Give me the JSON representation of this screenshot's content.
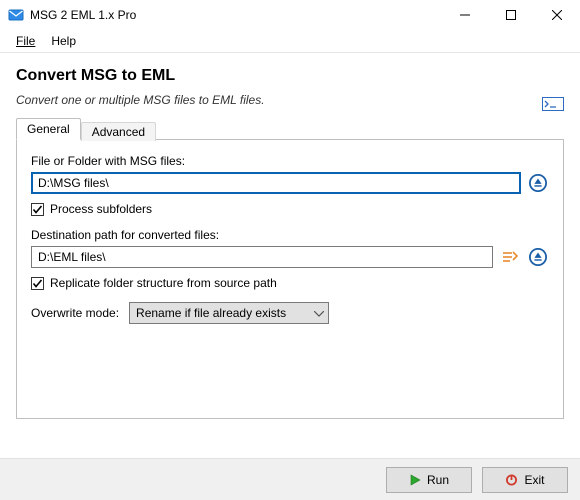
{
  "window": {
    "title": "MSG 2 EML 1.x Pro"
  },
  "menu": {
    "file": "File",
    "help": "Help"
  },
  "page": {
    "heading": "Convert MSG to EML",
    "subheading": "Convert one or multiple MSG files to EML files."
  },
  "tabs": {
    "general": "General",
    "advanced": "Advanced"
  },
  "general": {
    "source_label": "File or Folder with MSG files:",
    "source_value": "D:\\MSG files\\",
    "process_subfolders_label": "Process subfolders",
    "process_subfolders_checked": true,
    "dest_label": "Destination path for converted files:",
    "dest_value": "D:\\EML files\\",
    "replicate_label": "Replicate folder structure from source path",
    "replicate_checked": true,
    "overwrite_label": "Overwrite mode:",
    "overwrite_value": "Rename if file already exists",
    "overwrite_options": [
      "Rename if file already exists"
    ]
  },
  "buttons": {
    "run": "Run",
    "exit": "Exit"
  }
}
